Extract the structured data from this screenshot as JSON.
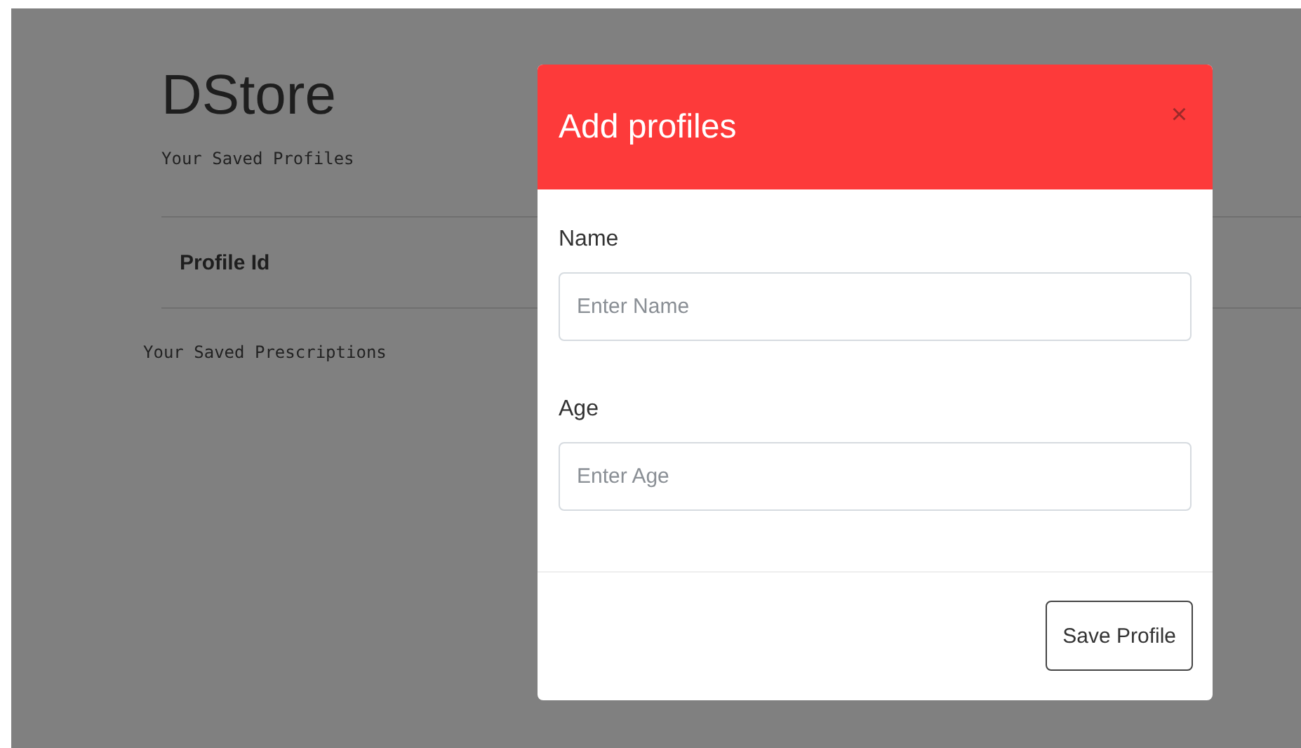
{
  "page": {
    "brand": "DStore",
    "profiles_heading": "Your Saved Profiles",
    "table": {
      "columns": [
        "Profile Id"
      ]
    },
    "prescriptions_heading": "Your Saved Prescriptions"
  },
  "modal": {
    "title": "Add profiles",
    "close": "×",
    "fields": [
      {
        "label": "Name",
        "placeholder": "Enter Name"
      },
      {
        "label": "Age",
        "placeholder": "Enter Age"
      }
    ],
    "buttons": [
      "Save Profile"
    ]
  }
}
